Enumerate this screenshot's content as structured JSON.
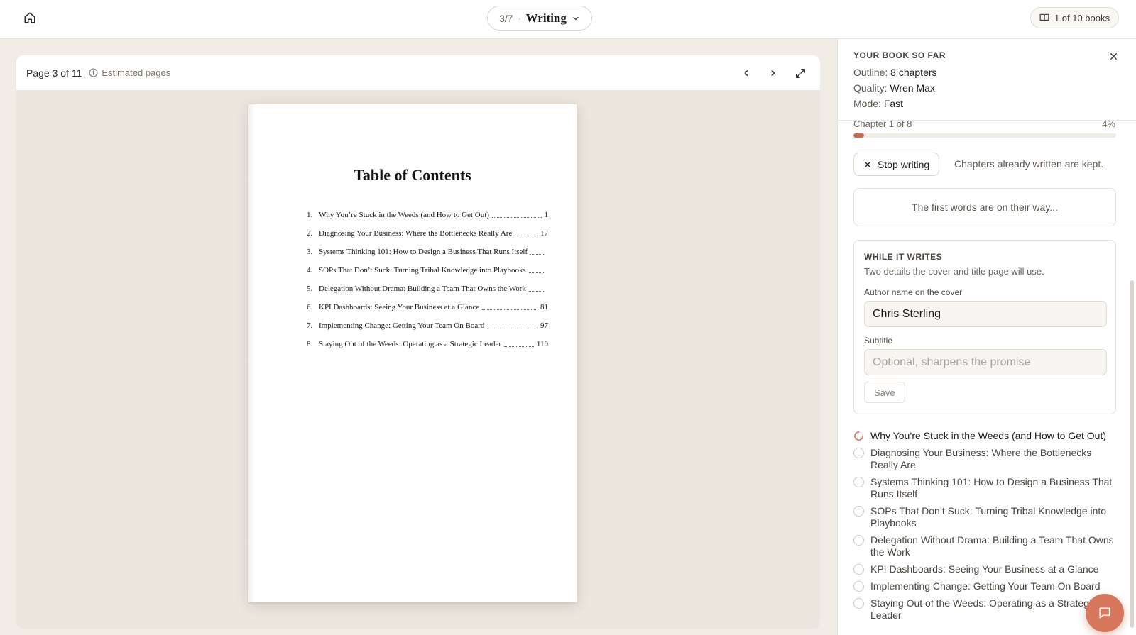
{
  "topbar": {
    "step_count": "3/7",
    "step_separator": "·",
    "step_name": "Writing",
    "books_label": "1 of 10 books"
  },
  "preview": {
    "page_indicator": "Page 3 of 11",
    "estimated_label": "Estimated pages",
    "toc": {
      "title": "Table of Contents",
      "entries": [
        {
          "num": "1.",
          "text": "Why You’re Stuck in the Weeds (and How to Get Out)",
          "page": "1"
        },
        {
          "num": "2.",
          "text": "Diagnosing Your Business: Where the Bottlenecks Really Are",
          "page": "17"
        },
        {
          "num": "3.",
          "text": "Systems Thinking 101: How to Design a Business That Runs Itself",
          "page": ""
        },
        {
          "num": "4.",
          "text": "SOPs That Don’t Suck: Turning Tribal Knowledge into Playbooks",
          "page": ""
        },
        {
          "num": "5.",
          "text": "Delegation Without Drama: Building a Team That Owns the Work",
          "page": ""
        },
        {
          "num": "6.",
          "text": "KPI Dashboards: Seeing Your Business at a Glance",
          "page": "81"
        },
        {
          "num": "7.",
          "text": "Implementing Change: Getting Your Team On Board",
          "page": "97"
        },
        {
          "num": "8.",
          "text": "Staying Out of the Weeds: Operating as a Strategic Leader",
          "page": "110"
        }
      ]
    }
  },
  "panel": {
    "title": "YOUR BOOK SO FAR",
    "outline_label": "Outline:",
    "outline_value": "8 chapters",
    "quality_label": "Quality:",
    "quality_value": "Wren Max",
    "mode_label": "Mode:",
    "mode_value": "Fast",
    "progress_label": "Chapter 1 of 8",
    "progress_pct": "4%",
    "progress_value": 4,
    "stop_label": "Stop writing",
    "stop_note": "Chapters already written are kept.",
    "status_text": "The first words are on their way...",
    "writes_card": {
      "title": "WHILE IT WRITES",
      "subtitle": "Two details the cover and title page will use.",
      "author_label": "Author name on the cover",
      "author_value": "Chris Sterling",
      "subtitle_label": "Subtitle",
      "subtitle_placeholder": "Optional, sharpens the promise",
      "save_label": "Save"
    },
    "chapters": [
      {
        "text": "Why You’re Stuck in the Weeds (and How to Get Out)",
        "state": "writing"
      },
      {
        "text": "Diagnosing Your Business: Where the Bottlenecks Really Are",
        "state": "pending"
      },
      {
        "text": "Systems Thinking 101: How to Design a Business That Runs Itself",
        "state": "pending"
      },
      {
        "text": "SOPs That Don’t Suck: Turning Tribal Knowledge into Playbooks",
        "state": "pending"
      },
      {
        "text": "Delegation Without Drama: Building a Team That Owns the Work",
        "state": "pending"
      },
      {
        "text": "KPI Dashboards: Seeing Your Business at a Glance",
        "state": "pending"
      },
      {
        "text": "Implementing Change: Getting Your Team On Board",
        "state": "pending"
      },
      {
        "text": "Staying Out of the Weeds: Operating as a Strategic Leader",
        "state": "pending"
      }
    ]
  },
  "colors": {
    "accent": "#c96a4f",
    "fab": "#d7785d",
    "preview_bg": "#ebe6de"
  },
  "icons": {
    "home": "home-icon",
    "chevron_down": "chevron-down-icon",
    "book": "book-icon",
    "info": "info-icon",
    "prev": "chevron-left-icon",
    "next": "chevron-right-icon",
    "expand": "expand-icon",
    "close": "close-icon",
    "stop": "x-icon",
    "spinner": "spinner-icon",
    "chat": "chat-icon"
  }
}
